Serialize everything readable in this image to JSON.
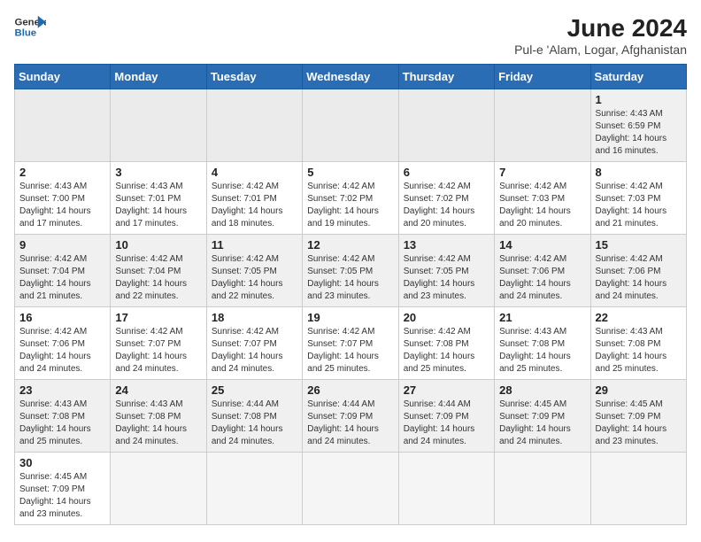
{
  "header": {
    "logo_general": "General",
    "logo_blue": "Blue",
    "title": "June 2024",
    "subtitle": "Pul-e 'Alam, Logar, Afghanistan"
  },
  "days_of_week": [
    "Sunday",
    "Monday",
    "Tuesday",
    "Wednesday",
    "Thursday",
    "Friday",
    "Saturday"
  ],
  "weeks": [
    {
      "days": [
        {
          "num": "",
          "info": ""
        },
        {
          "num": "",
          "info": ""
        },
        {
          "num": "",
          "info": ""
        },
        {
          "num": "",
          "info": ""
        },
        {
          "num": "",
          "info": ""
        },
        {
          "num": "",
          "info": ""
        },
        {
          "num": "1",
          "info": "Sunrise: 4:43 AM\nSunset: 6:59 PM\nDaylight: 14 hours\nand 16 minutes."
        }
      ]
    },
    {
      "days": [
        {
          "num": "2",
          "info": "Sunrise: 4:43 AM\nSunset: 7:00 PM\nDaylight: 14 hours\nand 17 minutes."
        },
        {
          "num": "3",
          "info": "Sunrise: 4:43 AM\nSunset: 7:01 PM\nDaylight: 14 hours\nand 17 minutes."
        },
        {
          "num": "4",
          "info": "Sunrise: 4:42 AM\nSunset: 7:01 PM\nDaylight: 14 hours\nand 18 minutes."
        },
        {
          "num": "5",
          "info": "Sunrise: 4:42 AM\nSunset: 7:02 PM\nDaylight: 14 hours\nand 19 minutes."
        },
        {
          "num": "6",
          "info": "Sunrise: 4:42 AM\nSunset: 7:02 PM\nDaylight: 14 hours\nand 20 minutes."
        },
        {
          "num": "7",
          "info": "Sunrise: 4:42 AM\nSunset: 7:03 PM\nDaylight: 14 hours\nand 20 minutes."
        },
        {
          "num": "8",
          "info": "Sunrise: 4:42 AM\nSunset: 7:03 PM\nDaylight: 14 hours\nand 21 minutes."
        }
      ]
    },
    {
      "days": [
        {
          "num": "9",
          "info": "Sunrise: 4:42 AM\nSunset: 7:04 PM\nDaylight: 14 hours\nand 21 minutes."
        },
        {
          "num": "10",
          "info": "Sunrise: 4:42 AM\nSunset: 7:04 PM\nDaylight: 14 hours\nand 22 minutes."
        },
        {
          "num": "11",
          "info": "Sunrise: 4:42 AM\nSunset: 7:05 PM\nDaylight: 14 hours\nand 22 minutes."
        },
        {
          "num": "12",
          "info": "Sunrise: 4:42 AM\nSunset: 7:05 PM\nDaylight: 14 hours\nand 23 minutes."
        },
        {
          "num": "13",
          "info": "Sunrise: 4:42 AM\nSunset: 7:05 PM\nDaylight: 14 hours\nand 23 minutes."
        },
        {
          "num": "14",
          "info": "Sunrise: 4:42 AM\nSunset: 7:06 PM\nDaylight: 14 hours\nand 24 minutes."
        },
        {
          "num": "15",
          "info": "Sunrise: 4:42 AM\nSunset: 7:06 PM\nDaylight: 14 hours\nand 24 minutes."
        }
      ]
    },
    {
      "days": [
        {
          "num": "16",
          "info": "Sunrise: 4:42 AM\nSunset: 7:06 PM\nDaylight: 14 hours\nand 24 minutes."
        },
        {
          "num": "17",
          "info": "Sunrise: 4:42 AM\nSunset: 7:07 PM\nDaylight: 14 hours\nand 24 minutes."
        },
        {
          "num": "18",
          "info": "Sunrise: 4:42 AM\nSunset: 7:07 PM\nDaylight: 14 hours\nand 24 minutes."
        },
        {
          "num": "19",
          "info": "Sunrise: 4:42 AM\nSunset: 7:07 PM\nDaylight: 14 hours\nand 25 minutes."
        },
        {
          "num": "20",
          "info": "Sunrise: 4:42 AM\nSunset: 7:08 PM\nDaylight: 14 hours\nand 25 minutes."
        },
        {
          "num": "21",
          "info": "Sunrise: 4:43 AM\nSunset: 7:08 PM\nDaylight: 14 hours\nand 25 minutes."
        },
        {
          "num": "22",
          "info": "Sunrise: 4:43 AM\nSunset: 7:08 PM\nDaylight: 14 hours\nand 25 minutes."
        }
      ]
    },
    {
      "days": [
        {
          "num": "23",
          "info": "Sunrise: 4:43 AM\nSunset: 7:08 PM\nDaylight: 14 hours\nand 25 minutes."
        },
        {
          "num": "24",
          "info": "Sunrise: 4:43 AM\nSunset: 7:08 PM\nDaylight: 14 hours\nand 24 minutes."
        },
        {
          "num": "25",
          "info": "Sunrise: 4:44 AM\nSunset: 7:08 PM\nDaylight: 14 hours\nand 24 minutes."
        },
        {
          "num": "26",
          "info": "Sunrise: 4:44 AM\nSunset: 7:09 PM\nDaylight: 14 hours\nand 24 minutes."
        },
        {
          "num": "27",
          "info": "Sunrise: 4:44 AM\nSunset: 7:09 PM\nDaylight: 14 hours\nand 24 minutes."
        },
        {
          "num": "28",
          "info": "Sunrise: 4:45 AM\nSunset: 7:09 PM\nDaylight: 14 hours\nand 24 minutes."
        },
        {
          "num": "29",
          "info": "Sunrise: 4:45 AM\nSunset: 7:09 PM\nDaylight: 14 hours\nand 23 minutes."
        }
      ]
    },
    {
      "days": [
        {
          "num": "30",
          "info": "Sunrise: 4:45 AM\nSunset: 7:09 PM\nDaylight: 14 hours\nand 23 minutes."
        },
        {
          "num": "",
          "info": ""
        },
        {
          "num": "",
          "info": ""
        },
        {
          "num": "",
          "info": ""
        },
        {
          "num": "",
          "info": ""
        },
        {
          "num": "",
          "info": ""
        },
        {
          "num": "",
          "info": ""
        }
      ]
    }
  ]
}
